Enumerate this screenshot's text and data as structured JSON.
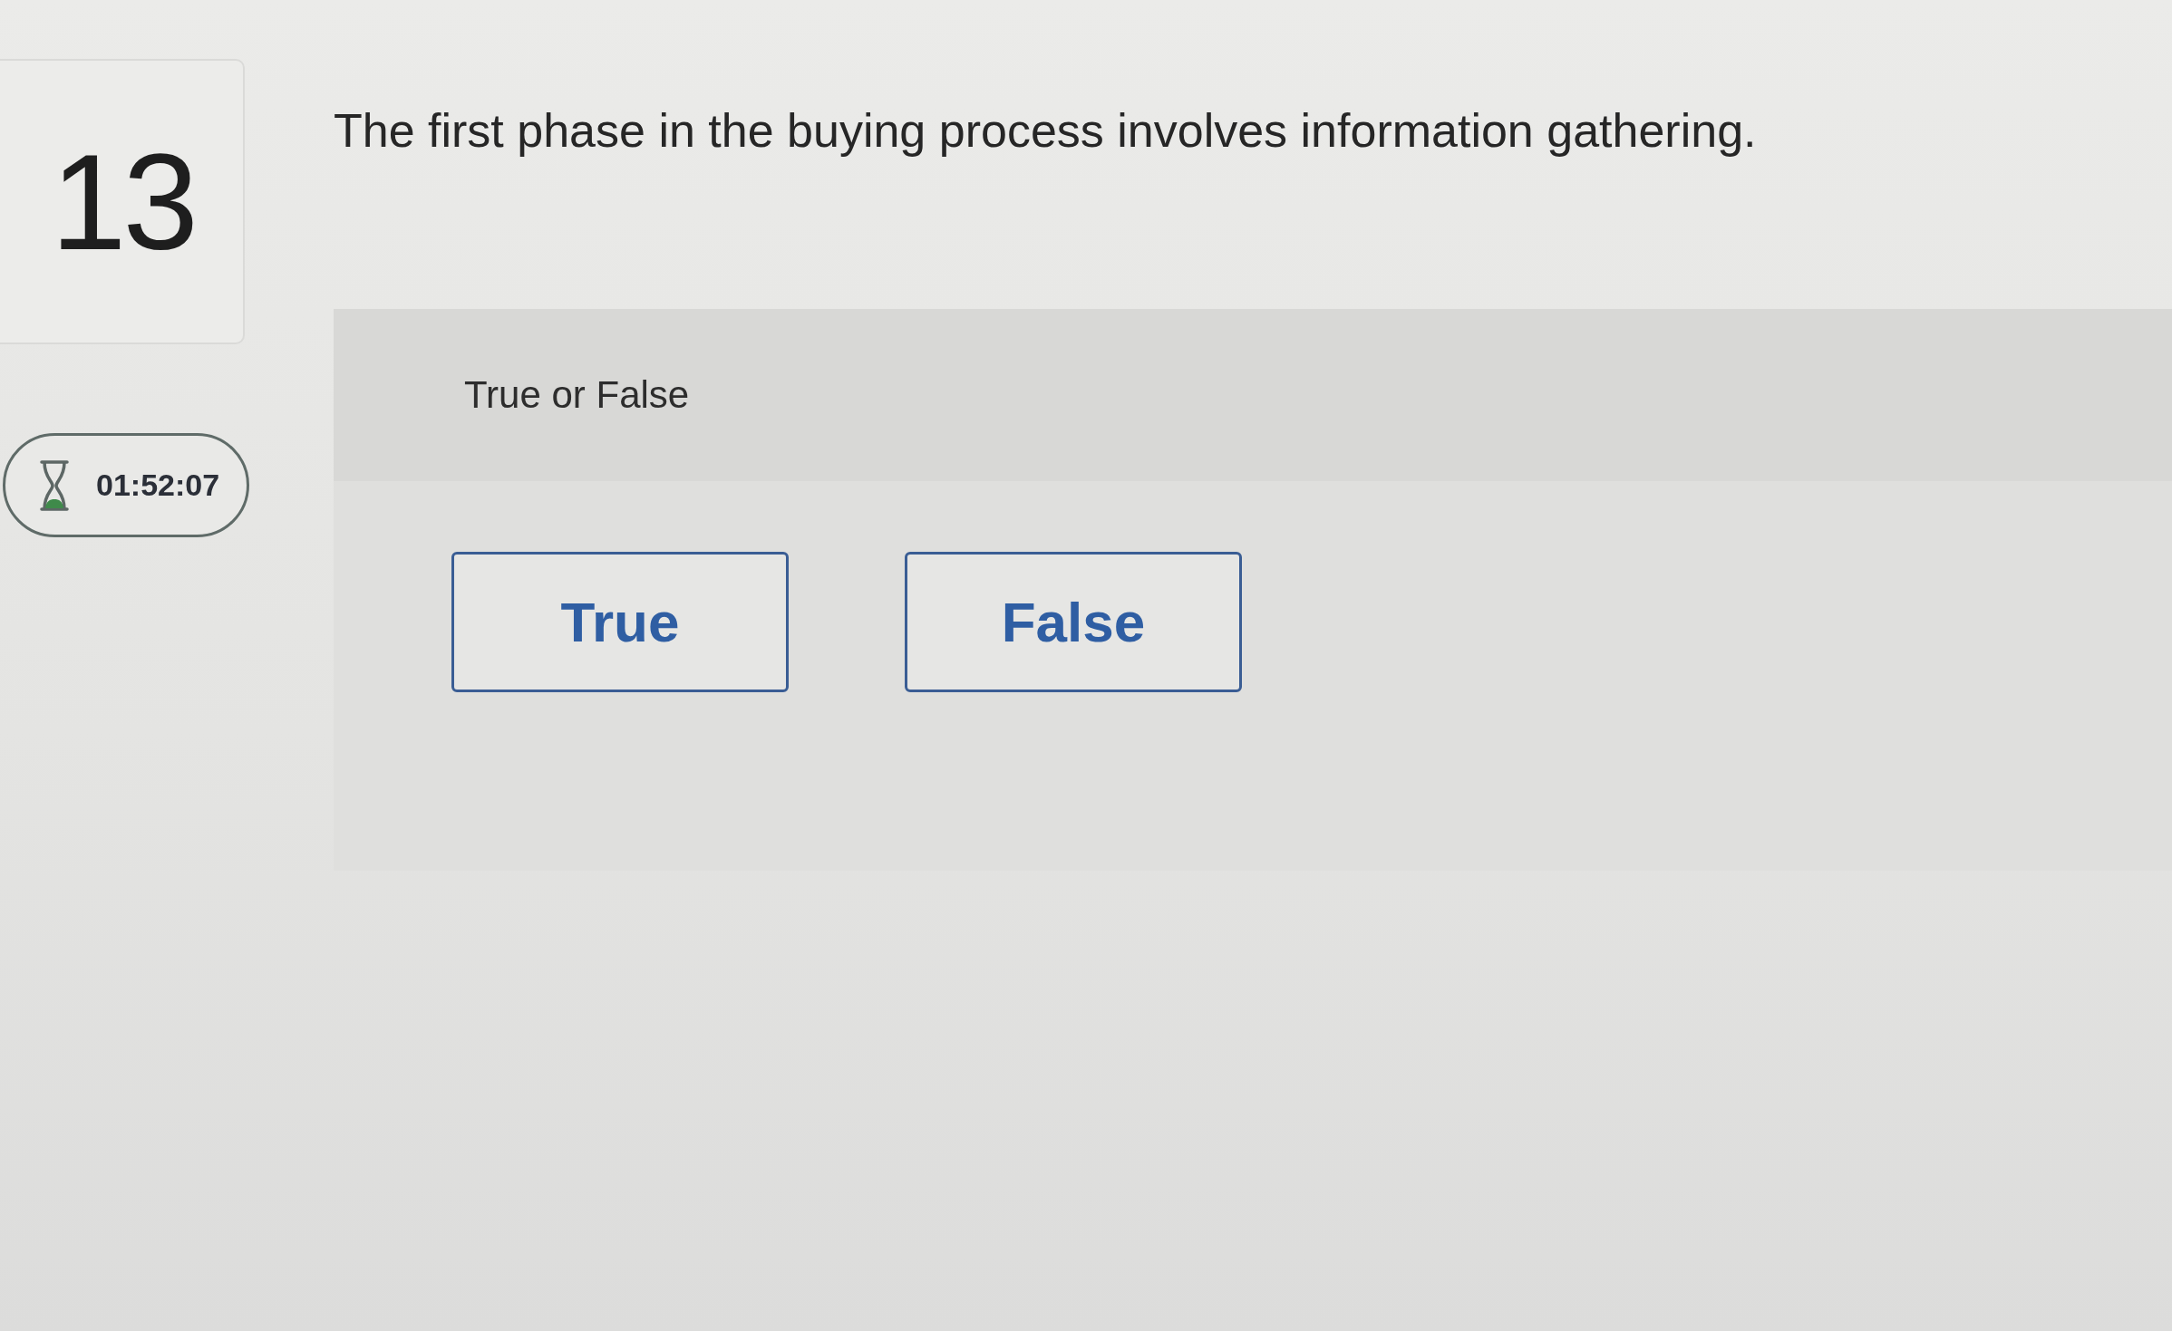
{
  "question": {
    "number": "13",
    "text": "The first phase in the buying process involves information gathering.",
    "timer": "01:52:07"
  },
  "answer_panel": {
    "type_label": "True or False",
    "options": [
      {
        "label": "True",
        "selected": false
      },
      {
        "label": "False",
        "selected": false
      }
    ]
  }
}
